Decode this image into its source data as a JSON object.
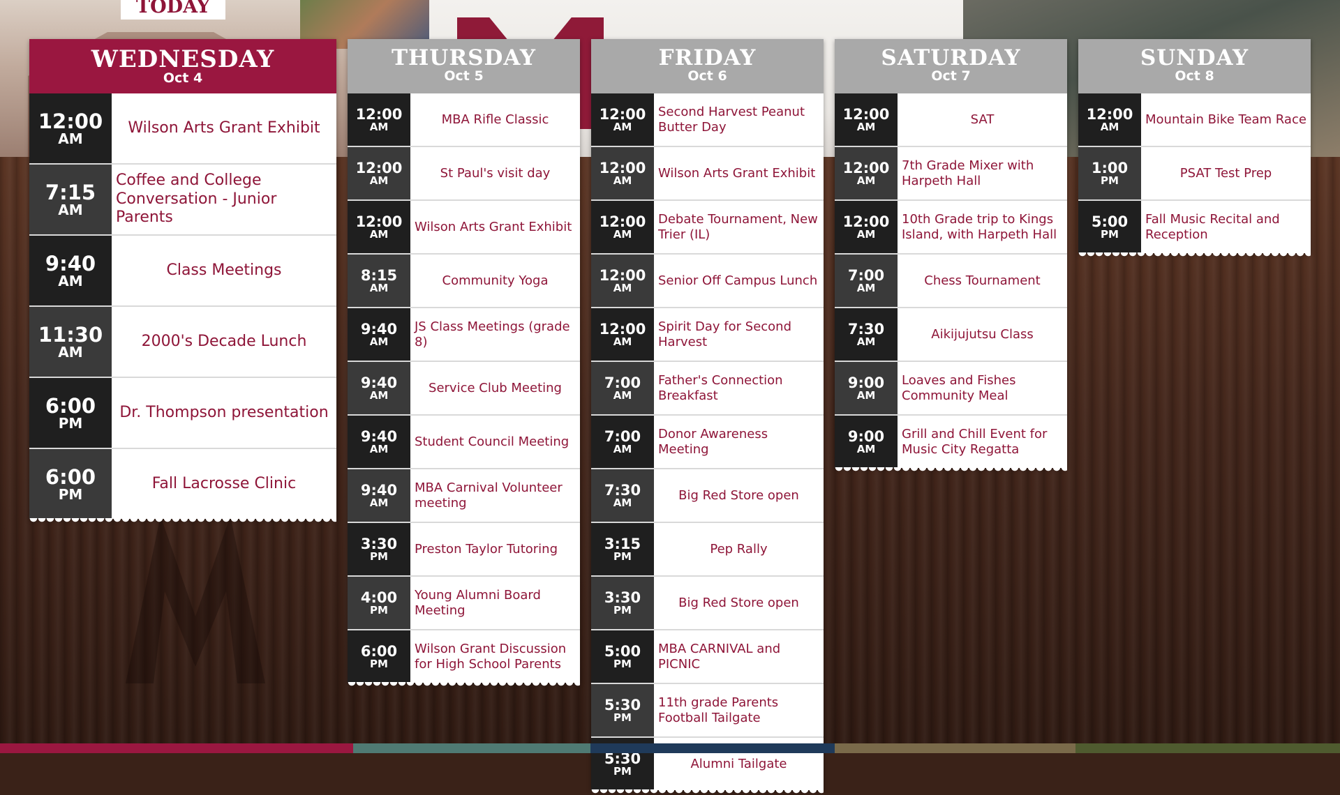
{
  "today_label": "TODAY",
  "colors": {
    "brand": "#9a1740",
    "event_text": "#8e1538",
    "header_gray": "#a9a9a9",
    "bottom_bar": [
      "#9a1740",
      "#4f7a73",
      "#1f3a5a",
      "#7a6a4a",
      "#4f5b2f"
    ]
  },
  "days": [
    {
      "name": "WEDNESDAY",
      "date": "Oct 4",
      "events": [
        {
          "time": "12:00",
          "meridiem": "AM",
          "title": "Wilson Arts Grant Exhibit"
        },
        {
          "time": "7:15",
          "meridiem": "AM",
          "title": "Coffee and College Conversation - Junior Parents"
        },
        {
          "time": "9:40",
          "meridiem": "AM",
          "title": "Class Meetings"
        },
        {
          "time": "11:30",
          "meridiem": "AM",
          "title": "2000's Decade Lunch"
        },
        {
          "time": "6:00",
          "meridiem": "PM",
          "title": "Dr. Thompson presentation"
        },
        {
          "time": "6:00",
          "meridiem": "PM",
          "title": "Fall Lacrosse Clinic"
        }
      ]
    },
    {
      "name": "THURSDAY",
      "date": "Oct 5",
      "events": [
        {
          "time": "12:00",
          "meridiem": "AM",
          "title": "MBA Rifle Classic"
        },
        {
          "time": "12:00",
          "meridiem": "AM",
          "title": "St Paul's visit day"
        },
        {
          "time": "12:00",
          "meridiem": "AM",
          "title": "Wilson Arts Grant Exhibit"
        },
        {
          "time": "8:15",
          "meridiem": "AM",
          "title": "Community Yoga"
        },
        {
          "time": "9:40",
          "meridiem": "AM",
          "title": "JS Class Meetings (grade 8)"
        },
        {
          "time": "9:40",
          "meridiem": "AM",
          "title": "Service Club Meeting"
        },
        {
          "time": "9:40",
          "meridiem": "AM",
          "title": "Student Council Meeting"
        },
        {
          "time": "9:40",
          "meridiem": "AM",
          "title": "MBA Carnival Volunteer meeting"
        },
        {
          "time": "3:30",
          "meridiem": "PM",
          "title": "Preston Taylor Tutoring"
        },
        {
          "time": "4:00",
          "meridiem": "PM",
          "title": "Young Alumni Board Meeting"
        },
        {
          "time": "6:00",
          "meridiem": "PM",
          "title": "Wilson Grant Discussion for High School Parents"
        }
      ]
    },
    {
      "name": "FRIDAY",
      "date": "Oct 6",
      "events": [
        {
          "time": "12:00",
          "meridiem": "AM",
          "title": "Second Harvest Peanut Butter Day"
        },
        {
          "time": "12:00",
          "meridiem": "AM",
          "title": "Wilson Arts Grant Exhibit"
        },
        {
          "time": "12:00",
          "meridiem": "AM",
          "title": "Debate Tournament, New Trier (IL)"
        },
        {
          "time": "12:00",
          "meridiem": "AM",
          "title": "Senior Off Campus Lunch"
        },
        {
          "time": "12:00",
          "meridiem": "AM",
          "title": "Spirit Day for Second Harvest"
        },
        {
          "time": "7:00",
          "meridiem": "AM",
          "title": "Father's Connection Breakfast"
        },
        {
          "time": "7:00",
          "meridiem": "AM",
          "title": "Donor Awareness Meeting"
        },
        {
          "time": "7:30",
          "meridiem": "AM",
          "title": "Big Red Store open"
        },
        {
          "time": "3:15",
          "meridiem": "PM",
          "title": "Pep Rally"
        },
        {
          "time": "3:30",
          "meridiem": "PM",
          "title": "Big Red Store open"
        },
        {
          "time": "5:00",
          "meridiem": "PM",
          "title": "MBA CARNIVAL and PICNIC"
        },
        {
          "time": "5:30",
          "meridiem": "PM",
          "title": "11th grade Parents Football Tailgate"
        },
        {
          "time": "5:30",
          "meridiem": "PM",
          "title": "Alumni Tailgate"
        }
      ]
    },
    {
      "name": "SATURDAY",
      "date": "Oct 7",
      "events": [
        {
          "time": "12:00",
          "meridiem": "AM",
          "title": "SAT"
        },
        {
          "time": "12:00",
          "meridiem": "AM",
          "title": "7th Grade Mixer with Harpeth Hall"
        },
        {
          "time": "12:00",
          "meridiem": "AM",
          "title": "10th Grade trip to Kings Island, with Harpeth Hall"
        },
        {
          "time": "7:00",
          "meridiem": "AM",
          "title": "Chess Tournament"
        },
        {
          "time": "7:30",
          "meridiem": "AM",
          "title": "Aikijujutsu Class"
        },
        {
          "time": "9:00",
          "meridiem": "AM",
          "title": "Loaves and Fishes Community Meal"
        },
        {
          "time": "9:00",
          "meridiem": "AM",
          "title": "Grill and Chill Event for Music City Regatta"
        }
      ]
    },
    {
      "name": "SUNDAY",
      "date": "Oct 8",
      "events": [
        {
          "time": "12:00",
          "meridiem": "AM",
          "title": "Mountain Bike Team Race"
        },
        {
          "time": "1:00",
          "meridiem": "PM",
          "title": "PSAT Test Prep"
        },
        {
          "time": "5:00",
          "meridiem": "PM",
          "title": "Fall Music Recital and Reception"
        }
      ]
    }
  ]
}
